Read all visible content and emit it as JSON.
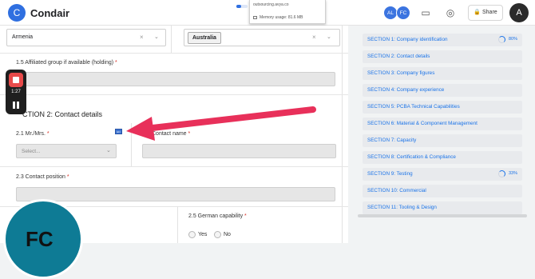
{
  "app": {
    "logo_letter": "C",
    "title": "Condair"
  },
  "popup": {
    "domain": "outsourcing.avya.co",
    "memory": "Memory usage: 81.6 MB",
    "load_progress": 0.45
  },
  "header": {
    "collaborators": [
      {
        "initials": "AL",
        "color": "#3b74e0"
      },
      {
        "initials": "FC",
        "color": "#3b74e0"
      }
    ],
    "share_label": "Share",
    "user_initial": "A"
  },
  "form": {
    "country_left": "Armenia",
    "country_right": "Australia",
    "affiliated_label": "1.5 Affiliated group if available (holding)",
    "section_title": "CTION 2: Contact details",
    "mr_mrs_label": "2.1 Mr./Mrs.",
    "select_placeholder": "Select...",
    "contact_name_label": "Contact name",
    "contact_position_label": "2.3 Contact position",
    "german_label": "2.5 German capability",
    "yes": "Yes",
    "no": "No",
    "flag_text": "EN"
  },
  "recorder": {
    "time": "1:27"
  },
  "webcam": {
    "initials": "FC"
  },
  "sections": [
    {
      "label": "SECTION 1: Company identification",
      "progress": "80%",
      "spinner": true
    },
    {
      "label": "SECTION 2: Contact details",
      "progress": "",
      "spinner": false
    },
    {
      "label": "SECTION 3: Company figures",
      "progress": "",
      "spinner": false
    },
    {
      "label": "SECTION 4: Company experience",
      "progress": "",
      "spinner": false
    },
    {
      "label": "SECTION 5: PCBA Technical Capabilities",
      "progress": "",
      "spinner": false
    },
    {
      "label": "SECTION 6: Material & Component Management",
      "progress": "",
      "spinner": false
    },
    {
      "label": "SECTION 7: Capacity",
      "progress": "",
      "spinner": false
    },
    {
      "label": "SECTION 8: Certification & Compliance",
      "progress": "",
      "spinner": false
    },
    {
      "label": "SECTION 9: Testing",
      "progress": "33%",
      "spinner": true
    },
    {
      "label": "SECTION 10: Commercial",
      "progress": "",
      "spinner": false
    },
    {
      "label": "SECTION 11: Tooling & Design",
      "progress": "",
      "spinner": false
    }
  ],
  "colors": {
    "accent": "#1a73e8",
    "arrow": "#e8305a",
    "required": "#d93025"
  }
}
